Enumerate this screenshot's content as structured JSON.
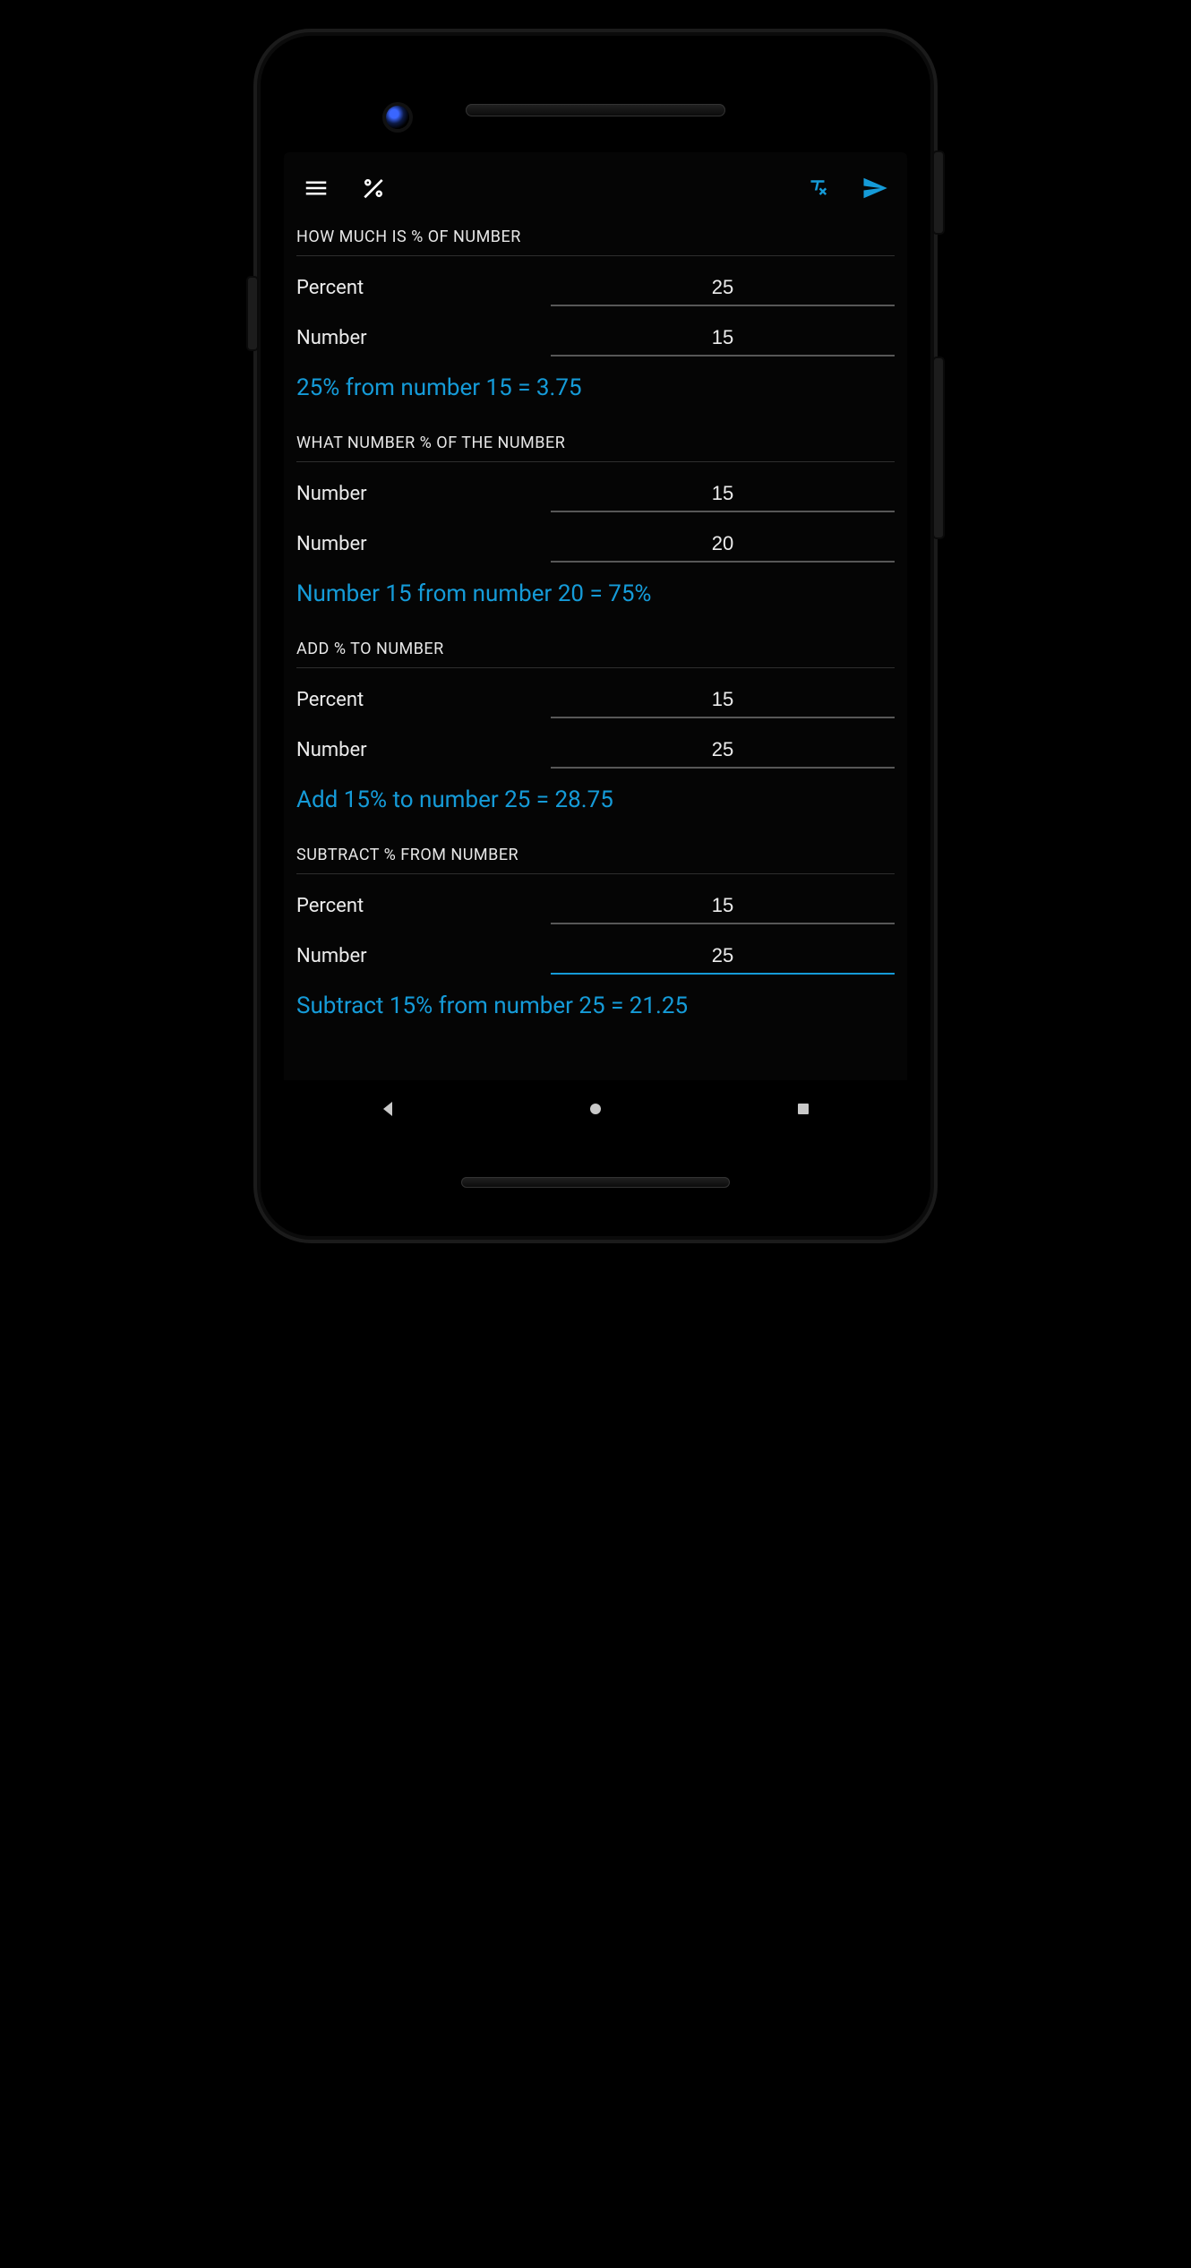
{
  "colors": {
    "accent": "#159bd8"
  },
  "icons": {
    "menu": "menu-icon",
    "percent": "percent-icon",
    "clear_format": "clear-format-icon",
    "send": "send-icon"
  },
  "sections": [
    {
      "id": "percent-of-number",
      "title": "HOW MUCH IS % OF NUMBER",
      "fields": [
        {
          "label": "Percent",
          "value": "25"
        },
        {
          "label": "Number",
          "value": "15"
        }
      ],
      "result": "25% from number 15 = 3.75"
    },
    {
      "id": "number-percent-of-number",
      "title": "WHAT NUMBER % OF THE NUMBER",
      "fields": [
        {
          "label": "Number",
          "value": "15"
        },
        {
          "label": "Number",
          "value": "20"
        }
      ],
      "result": "Number 15 from number 20 = 75%"
    },
    {
      "id": "add-percent",
      "title": "ADD % TO NUMBER",
      "fields": [
        {
          "label": "Percent",
          "value": "15"
        },
        {
          "label": "Number",
          "value": "25"
        }
      ],
      "result": "Add 15% to number 25 = 28.75"
    },
    {
      "id": "subtract-percent",
      "title": "SUBTRACT % FROM NUMBER",
      "fields": [
        {
          "label": "Percent",
          "value": "15"
        },
        {
          "label": "Number",
          "value": "25",
          "focused": true
        }
      ],
      "result": "Subtract 15% from number 25 = 21.25"
    }
  ]
}
